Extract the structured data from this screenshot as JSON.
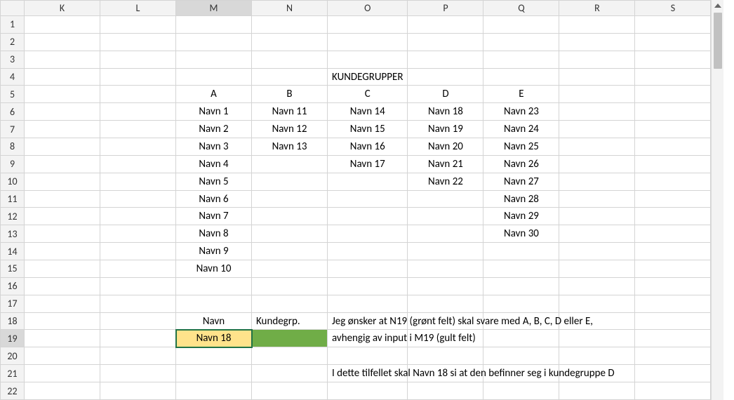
{
  "columns": [
    "K",
    "L",
    "M",
    "N",
    "O",
    "P",
    "Q",
    "R",
    "S"
  ],
  "rows": [
    "1",
    "2",
    "3",
    "4",
    "5",
    "6",
    "7",
    "8",
    "9",
    "10",
    "11",
    "12",
    "13",
    "14",
    "15",
    "16",
    "17",
    "18",
    "19",
    "20",
    "21",
    "22"
  ],
  "selected": {
    "col": "M",
    "row": "19"
  },
  "cells": {
    "r4": {
      "O": {
        "text": "KUNDEGRUPPER",
        "bold": true,
        "center": true
      }
    },
    "r5": {
      "M": {
        "text": "A",
        "bold": true,
        "center": true
      },
      "N": {
        "text": "B",
        "bold": true,
        "center": true
      },
      "O": {
        "text": "C",
        "bold": true,
        "center": true
      },
      "P": {
        "text": "D",
        "bold": true,
        "center": true
      },
      "Q": {
        "text": "E",
        "bold": true,
        "center": true
      }
    },
    "r6": {
      "M": {
        "text": "Navn 1",
        "center": true
      },
      "N": {
        "text": "Navn 11",
        "center": true
      },
      "O": {
        "text": "Navn 14",
        "center": true
      },
      "P": {
        "text": "Navn 18",
        "center": true
      },
      "Q": {
        "text": "Navn 23",
        "center": true
      }
    },
    "r7": {
      "M": {
        "text": "Navn 2",
        "center": true
      },
      "N": {
        "text": "Navn 12",
        "center": true
      },
      "O": {
        "text": "Navn 15",
        "center": true
      },
      "P": {
        "text": "Navn 19",
        "center": true
      },
      "Q": {
        "text": "Navn 24",
        "center": true
      }
    },
    "r8": {
      "M": {
        "text": "Navn 3",
        "center": true
      },
      "N": {
        "text": "Navn 13",
        "center": true
      },
      "O": {
        "text": "Navn 16",
        "center": true
      },
      "P": {
        "text": "Navn 20",
        "center": true
      },
      "Q": {
        "text": "Navn 25",
        "center": true
      }
    },
    "r9": {
      "M": {
        "text": "Navn 4",
        "center": true
      },
      "O": {
        "text": "Navn 17",
        "center": true
      },
      "P": {
        "text": "Navn 21",
        "center": true
      },
      "Q": {
        "text": "Navn 26",
        "center": true
      }
    },
    "r10": {
      "M": {
        "text": "Navn 5",
        "center": true
      },
      "P": {
        "text": "Navn 22",
        "center": true
      },
      "Q": {
        "text": "Navn 27",
        "center": true
      }
    },
    "r11": {
      "M": {
        "text": "Navn 6",
        "center": true
      },
      "Q": {
        "text": "Navn 28",
        "center": true
      }
    },
    "r12": {
      "M": {
        "text": "Navn 7",
        "center": true
      },
      "Q": {
        "text": "Navn 29",
        "center": true
      }
    },
    "r13": {
      "M": {
        "text": "Navn 8",
        "center": true
      },
      "Q": {
        "text": "Navn 30",
        "center": true
      }
    },
    "r14": {
      "M": {
        "text": "Navn 9",
        "center": true
      }
    },
    "r15": {
      "M": {
        "text": "Navn 10",
        "center": true
      }
    },
    "r18": {
      "M": {
        "text": "Navn",
        "center": true
      },
      "N": {
        "text": "Kundegrp."
      },
      "O": {
        "text": "Jeg ønsker at N19 (grønt felt) skal svare med A, B, C, D eller E,",
        "overflow": true
      }
    },
    "r19": {
      "M": {
        "text": "Navn 18",
        "center": true,
        "fill": "yellow",
        "active": true
      },
      "N": {
        "text": "",
        "fill": "green"
      },
      "O": {
        "text": "avhengig av input i M19 (gult felt)",
        "overflow": true
      }
    },
    "r21": {
      "O": {
        "text": "I dette tilfellet skal Navn 18 si at den befinner seg i kundegruppe D",
        "overflow": true
      }
    }
  }
}
